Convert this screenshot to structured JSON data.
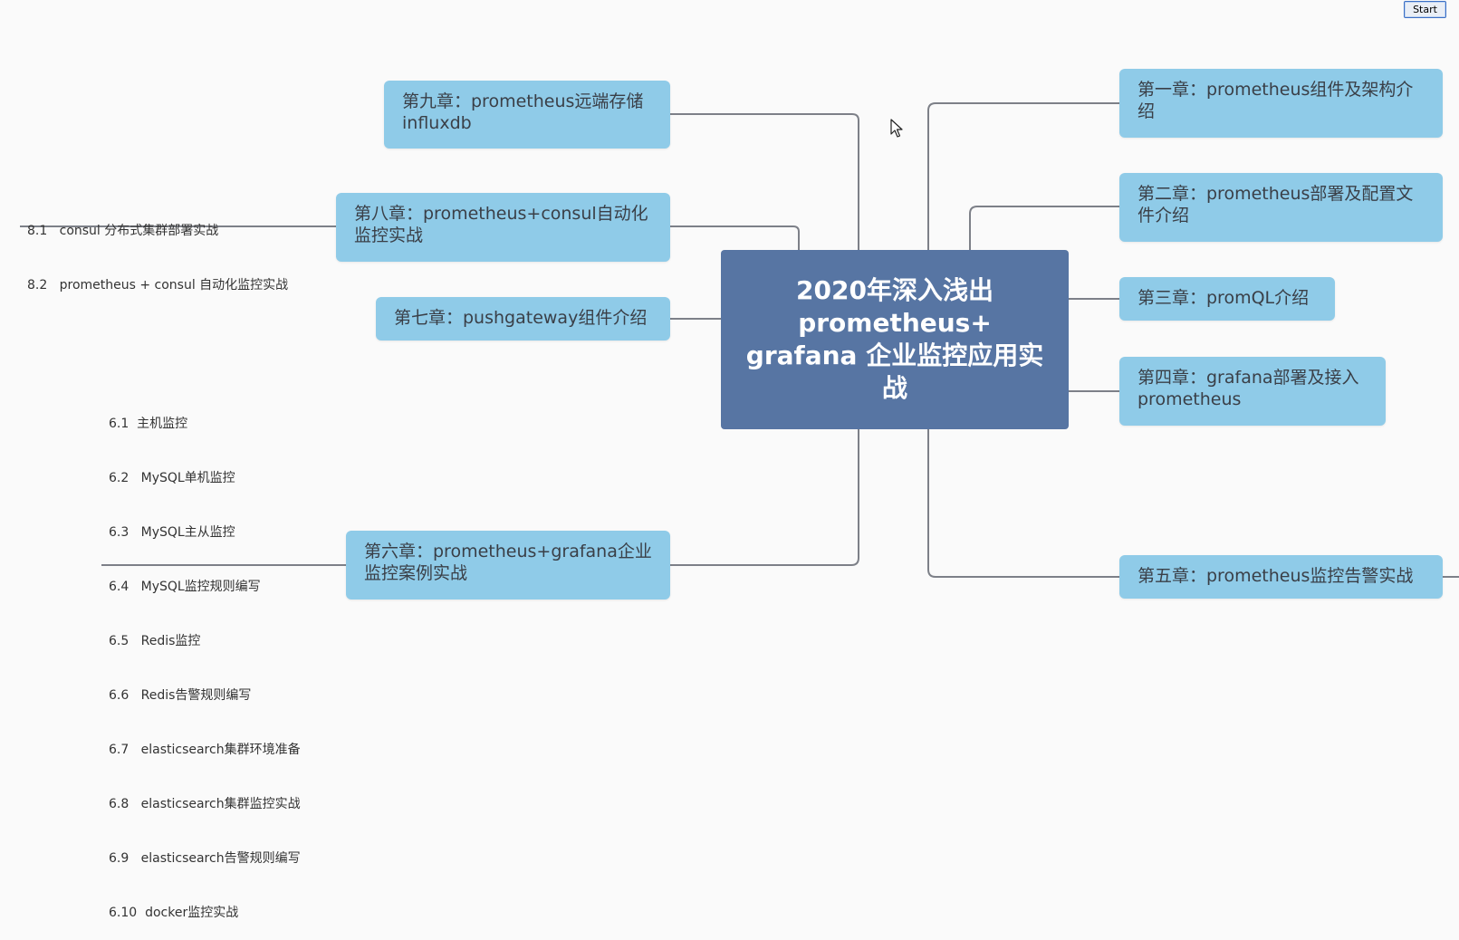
{
  "central_topic": "2020年深入浅出 prometheus+ grafana  企业监控应用实战",
  "start_button_label": "Start",
  "right_chapters": [
    "第一章：prometheus组件及架构介绍",
    "第二章：prometheus部署及配置文件介绍",
    "第三章：promQL介绍",
    "第四章：grafana部署及接入prometheus",
    "第五章：prometheus监控告警实战"
  ],
  "left_chapters": {
    "ch9": "第九章：prometheus远端存储influxdb",
    "ch8": "第八章：prometheus+consul自动化监控实战",
    "ch7": "第七章：pushgateway组件介绍",
    "ch6": "第六章：prometheus+grafana企业监控案例实战"
  },
  "ch8_sections": [
    "8.1   consul 分布式集群部署实战",
    "8.2   prometheus + consul 自动化监控实战"
  ],
  "ch6_sections": [
    "6.1  主机监控",
    "6.2   MySQL单机监控",
    "6.3   MySQL主从监控",
    "6.4   MySQL监控规则编写",
    "6.5   Redis监控",
    "6.6   Redis告警规则编写",
    "6.7   elasticsearch集群环境准备",
    "6.8   elasticsearch集群监控实战",
    "6.9   elasticsearch告警规则编写",
    "6.10  docker监控实战"
  ],
  "colors": {
    "central_bg": "#5775a3",
    "node_bg": "#8fcbe8",
    "connector": "#7d8088",
    "background": "#fafafa"
  }
}
